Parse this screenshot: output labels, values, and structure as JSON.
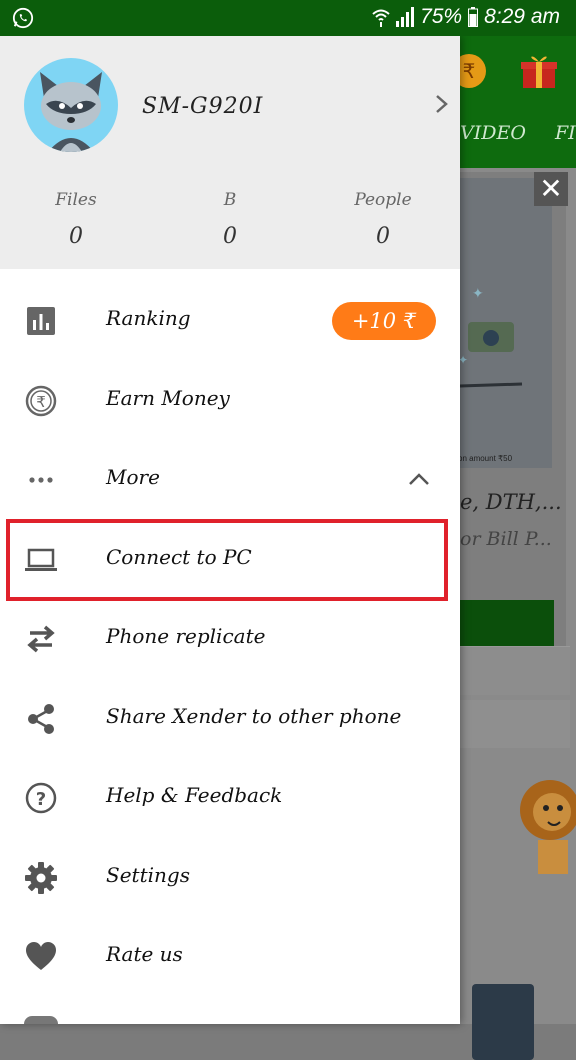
{
  "status_bar": {
    "battery": "75%",
    "time": "8:29 am"
  },
  "background_app": {
    "tab_video": "VIDEO",
    "tab_partial": "FI",
    "card_note": "on amount ₹50",
    "card_text_1": "e, DTH,...",
    "card_text_2": "or Bill P..."
  },
  "drawer": {
    "device_name": "SM-G920I",
    "stats": [
      {
        "label": "Files",
        "value": "0"
      },
      {
        "label": "B",
        "value": "0"
      },
      {
        "label": "People",
        "value": "0"
      }
    ],
    "menu": [
      {
        "label": "Ranking",
        "icon": "bar-chart-icon"
      },
      {
        "label": "Earn Money",
        "icon": "rupee-icon"
      },
      {
        "label": "More",
        "icon": "more-horiz-icon"
      },
      {
        "label": "Connect to PC",
        "icon": "laptop-icon"
      },
      {
        "label": "Phone replicate",
        "icon": "swap-arrows-icon"
      },
      {
        "label": "Share Xender to other phone",
        "icon": "share-icon"
      },
      {
        "label": "Help & Feedback",
        "icon": "help-icon"
      },
      {
        "label": "Settings",
        "icon": "gear-icon"
      },
      {
        "label": "Rate us",
        "icon": "heart-icon"
      }
    ],
    "ranking_badge": "+10 ₹",
    "highlight_color": "#e0212b"
  }
}
